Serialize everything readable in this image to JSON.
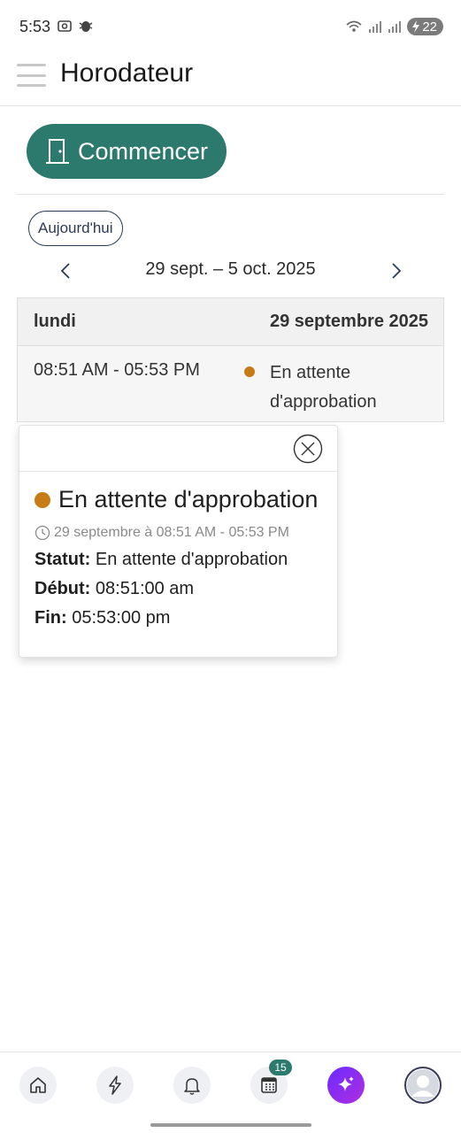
{
  "status_bar": {
    "time": "5:53",
    "battery": "22",
    "icons": [
      "screenshot-icon",
      "bug-icon",
      "wifi-icon",
      "signal-icon",
      "signal-icon",
      "charging-icon"
    ]
  },
  "app_bar": {
    "title": "Horodateur"
  },
  "actions": {
    "start_label": "Commencer",
    "today_label": "Aujourd'hui"
  },
  "week": {
    "range": "29 sept. – 5 oct. 2025"
  },
  "day": {
    "weekday": "lundi",
    "date": "29 septembre 2025",
    "entries": [
      {
        "time": "08:51 AM - 05:53 PM",
        "status": "En attente d'approbation"
      }
    ]
  },
  "popover": {
    "title": "En attente d'approbation",
    "time_range": "29 septembre à 08:51 AM - 05:53 PM",
    "status_label": "Statut:",
    "status_value": "En attente d'approbation",
    "start_label": "Début:",
    "start_value": "08:51:00 am",
    "end_label": "Fin:",
    "end_value": "05:53:00 pm"
  },
  "bottom_nav": {
    "items": [
      "home-icon",
      "lightning-icon",
      "bell-icon",
      "timesheet-icon",
      "ai-sparkle-icon",
      "profile-avatar"
    ],
    "badge": "15"
  },
  "colors": {
    "primary": "#2c7a6e",
    "pending": "#c77b15",
    "outline": "#2b3a55"
  }
}
